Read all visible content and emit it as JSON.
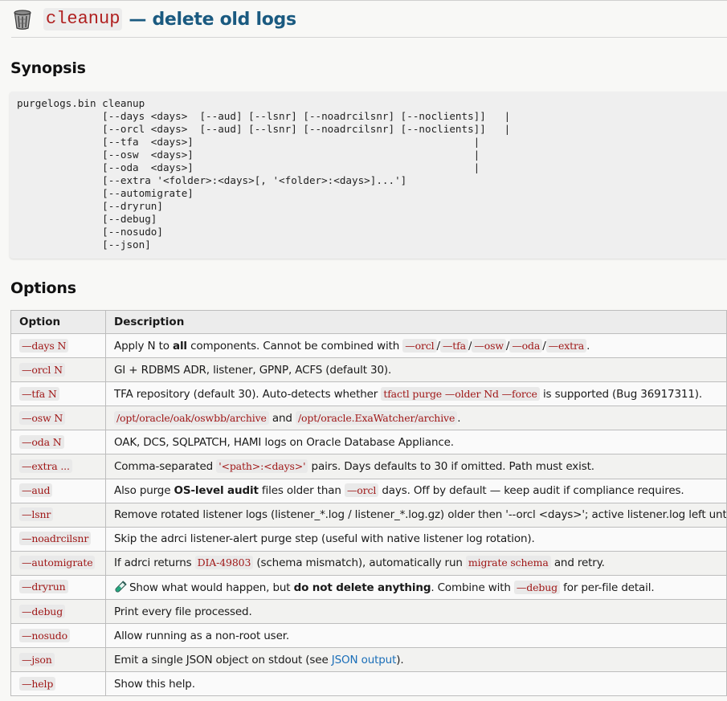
{
  "title": {
    "code": "cleanup",
    "rest": "— delete old logs",
    "icon": "wastebasket-icon"
  },
  "synopsis": {
    "heading": "Synopsis",
    "lines": [
      "purgelogs.bin cleanup",
      "              [--days <days>  [--aud] [--lsnr] [--noadrcilsnr] [--noclients]]   |",
      "              [--orcl <days>  [--aud] [--lsnr] [--noadrcilsnr] [--noclients]]   |",
      "              [--tfa  <days>]                                              |",
      "              [--osw  <days>]                                              |",
      "              [--oda  <days>]                                              |",
      "              [--extra '<folder>:<days>[, '<folder>:<days>]...']",
      "              [--automigrate]",
      "              [--dryrun]",
      "              [--debug]",
      "              [--nosudo]",
      "              [--json]"
    ]
  },
  "options": {
    "heading": "Options",
    "headers": [
      "Option",
      "Description"
    ],
    "rows": [
      {
        "opt": "—days N",
        "desc": [
          {
            "t": "Apply N to "
          },
          {
            "b": "all"
          },
          {
            "t": " components. Cannot be combined with "
          },
          {
            "c": "—orcl"
          },
          {
            "t": "/"
          },
          {
            "c": "—tfa"
          },
          {
            "t": "/"
          },
          {
            "c": "—osw"
          },
          {
            "t": "/"
          },
          {
            "c": "—oda"
          },
          {
            "t": "/"
          },
          {
            "c": "—extra"
          },
          {
            "t": "."
          }
        ]
      },
      {
        "opt": "—orcl N",
        "desc": [
          {
            "t": "GI + RDBMS ADR, listener, GPNP, ACFS (default 30)."
          }
        ]
      },
      {
        "opt": "—tfa N",
        "desc": [
          {
            "t": "TFA repository (default 30). Auto-detects whether "
          },
          {
            "c": "tfactl purge —older Nd —force"
          },
          {
            "t": " is supported (Bug 36917311)."
          }
        ]
      },
      {
        "opt": "—osw N",
        "desc": [
          {
            "c": "/opt/oracle/oak/oswbb/archive"
          },
          {
            "t": " and "
          },
          {
            "c": "/opt/oracle.ExaWatcher/archive"
          },
          {
            "t": "."
          }
        ]
      },
      {
        "opt": "—oda N",
        "desc": [
          {
            "t": "OAK, DCS, SQLPATCH, HAMI logs on Oracle Database Appliance."
          }
        ]
      },
      {
        "opt": "—extra ...",
        "desc": [
          {
            "t": "Comma-separated "
          },
          {
            "c": "'<path>:<days>'"
          },
          {
            "t": " pairs. Days defaults to 30 if omitted. Path must exist."
          }
        ]
      },
      {
        "opt": "—aud",
        "desc": [
          {
            "t": "Also purge "
          },
          {
            "b": "OS-level audit"
          },
          {
            "t": " files older than "
          },
          {
            "c": "—orcl"
          },
          {
            "t": " days. Off by default — keep audit if compliance requires."
          }
        ]
      },
      {
        "opt": "—lsnr",
        "desc": [
          {
            "t": "Remove rotated listener logs (listener_*.log / listener_*.log.gz) older then '--orcl <days>'; active listener.log left untouched"
          }
        ]
      },
      {
        "opt": "—noadrcilsnr",
        "desc": [
          {
            "t": "Skip the adrci listener-alert purge step (useful with native listener log rotation)."
          }
        ]
      },
      {
        "opt": "—automigrate",
        "desc": [
          {
            "t": "If adrci returns "
          },
          {
            "c": "DIA-49803"
          },
          {
            "t": " (schema mismatch), automatically run "
          },
          {
            "c": "migrate schema"
          },
          {
            "t": " and retry."
          }
        ]
      },
      {
        "opt": "—dryrun",
        "desc": [
          {
            "i": "test-tube-icon"
          },
          {
            "t": "Show what would happen, but "
          },
          {
            "b": "do not delete anything"
          },
          {
            "t": ". Combine with "
          },
          {
            "c": "—debug"
          },
          {
            "t": " for per-file detail."
          }
        ]
      },
      {
        "opt": "—debug",
        "desc": [
          {
            "t": "Print every file processed."
          }
        ]
      },
      {
        "opt": "—nosudo",
        "desc": [
          {
            "t": "Allow running as a non-root user."
          }
        ]
      },
      {
        "opt": "—json",
        "desc": [
          {
            "t": "Emit a single JSON object on stdout (see "
          },
          {
            "l": "JSON output"
          },
          {
            "t": ")."
          }
        ]
      },
      {
        "opt": "—help",
        "desc": [
          {
            "t": "Show this help."
          }
        ]
      }
    ]
  },
  "colors": {
    "title": "#1a5a80",
    "code": "#a01818",
    "link": "#1a6eb8"
  }
}
